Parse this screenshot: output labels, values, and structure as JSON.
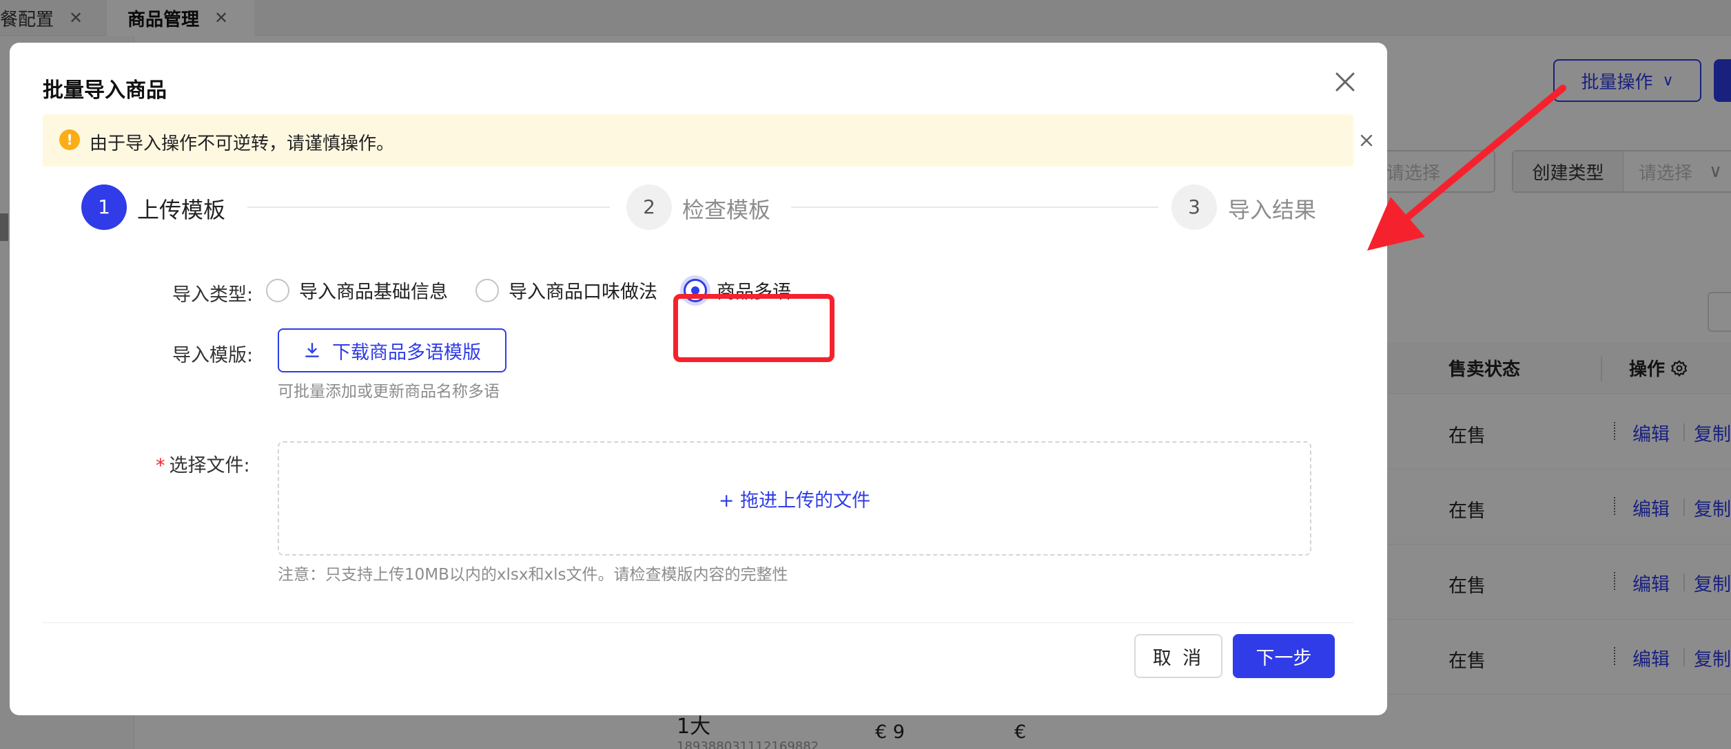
{
  "tabs": [
    {
      "label": "餐配置"
    },
    {
      "label": "商品管理"
    }
  ],
  "background": {
    "batch_button_label": "批量操作",
    "select_placeholder": "请选择",
    "create_type_label": "创建类型",
    "create_type_placeholder": "请选择",
    "columns": {
      "sale_status": "售卖状态",
      "operation": "操作"
    },
    "rows": [
      {
        "status": "在售",
        "edit": "编辑",
        "copy": "复制"
      },
      {
        "status": "在售",
        "edit": "编辑",
        "copy": "复制"
      },
      {
        "status": "在售",
        "edit": "编辑",
        "copy": "复制"
      },
      {
        "status": "在售",
        "edit": "编辑",
        "copy": "复制"
      }
    ],
    "partial_row": {
      "name": "1大",
      "code": "189388031112169882",
      "price1": "€  9",
      "price2": "€"
    }
  },
  "modal": {
    "title": "批量导入商品",
    "alert_text": "由于导入操作不可逆转，请谨慎操作。",
    "steps": [
      {
        "number": "1",
        "label": "上传模板",
        "active": true
      },
      {
        "number": "2",
        "label": "检查模板",
        "active": false
      },
      {
        "number": "3",
        "label": "导入结果",
        "active": false
      }
    ],
    "import_type_label": "导入类型:",
    "import_types": [
      {
        "label": "导入商品基础信息",
        "checked": false
      },
      {
        "label": "导入商品口味做法",
        "checked": false
      },
      {
        "label": "商品多语",
        "checked": true
      }
    ],
    "template_label": "导入模版:",
    "download_button": "下载商品多语模版",
    "template_hint": "可批量添加或更新商品名称多语",
    "file_label": "选择文件:",
    "upload_text": "+ 拖进上传的文件",
    "upload_hint": "注意：只支持上传10MB以内的xlsx和xls文件。请检查模版内容的完整性",
    "cancel_button": "取 消",
    "next_button": "下一步"
  },
  "colors": {
    "primary": "#2f3ce8",
    "highlight_red": "#f5222d",
    "warning": "#faad14",
    "alert_bg": "#fff8e1"
  }
}
